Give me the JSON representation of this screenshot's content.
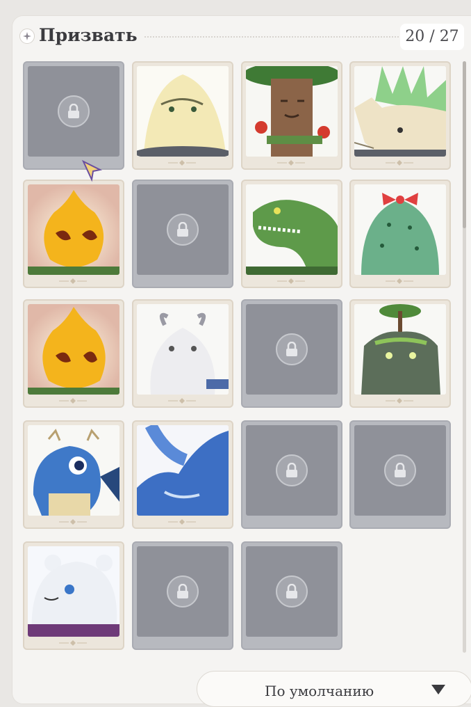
{
  "header": {
    "title": "Призвать",
    "counter": "20 / 27",
    "icon": "sparkle-icon"
  },
  "grid": {
    "rows": [
      [
        {
          "state": "locked"
        },
        {
          "state": "unlocked",
          "creature": "yellow-blob-creature"
        },
        {
          "state": "unlocked",
          "creature": "tree-stump-creature"
        },
        {
          "state": "unlocked",
          "creature": "leaf-hedgehog-creature"
        }
      ],
      [
        {
          "state": "unlocked",
          "creature": "fire-spirit-creature"
        },
        {
          "state": "locked"
        },
        {
          "state": "unlocked",
          "creature": "green-dinosaur-creature"
        },
        {
          "state": "unlocked",
          "creature": "cactus-creature"
        }
      ],
      [
        {
          "state": "unlocked",
          "creature": "fire-spirit-creature"
        },
        {
          "state": "unlocked",
          "creature": "white-goat-creature"
        },
        {
          "state": "locked"
        },
        {
          "state": "unlocked",
          "creature": "rock-golem-creature"
        }
      ],
      [
        {
          "state": "unlocked",
          "creature": "blue-dragon-creature"
        },
        {
          "state": "unlocked",
          "creature": "blue-whale-creature"
        },
        {
          "state": "locked"
        },
        {
          "state": "locked"
        }
      ],
      [
        {
          "state": "unlocked",
          "creature": "white-bear-creature"
        },
        {
          "state": "locked"
        },
        {
          "state": "locked"
        }
      ]
    ]
  },
  "sort": {
    "label": "По умолчанию",
    "icon": "triangle-down-icon"
  },
  "colors": {
    "panel": "#f5f4f2",
    "locked_card": "#b7b9bf",
    "unlocked_card": "#ece6dc",
    "title_text": "#3b3b3f"
  }
}
